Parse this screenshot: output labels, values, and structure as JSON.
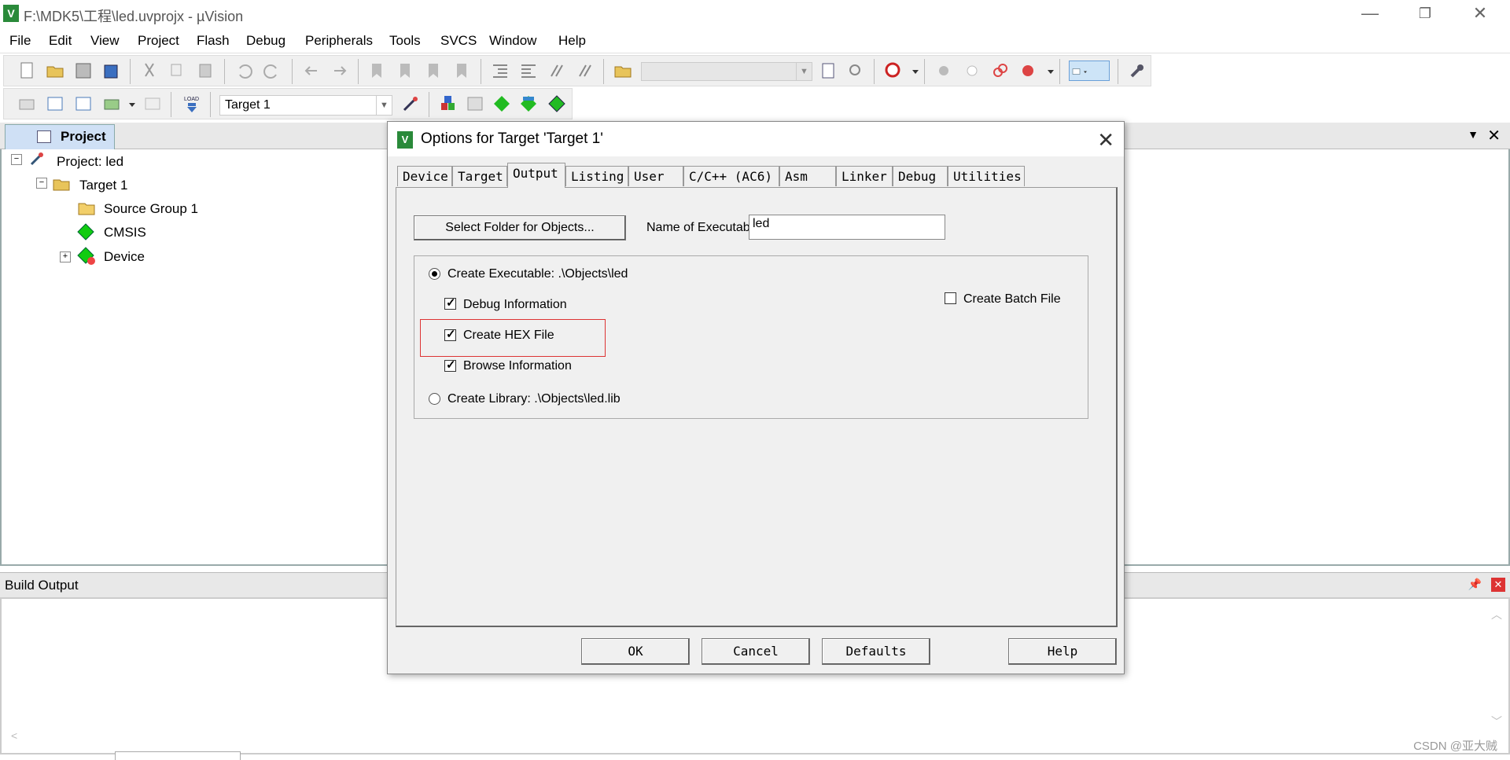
{
  "window": {
    "title": "F:\\MDK5\\工程\\led.uvprojx - µVision",
    "app_icon": "V"
  },
  "menubar": {
    "items": [
      "File",
      "Edit",
      "View",
      "Project",
      "Flash",
      "Debug",
      "Peripherals",
      "Tools",
      "SVCS",
      "Window",
      "Help"
    ]
  },
  "toolbar2": {
    "target_select": "Target 1",
    "load_label": "LOAD"
  },
  "project_panel": {
    "tab_label": "Project",
    "tree": [
      {
        "label": "Project: led"
      },
      {
        "label": "Target 1"
      },
      {
        "label": "Source Group 1"
      },
      {
        "label": "CMSIS"
      },
      {
        "label": "Device"
      }
    ]
  },
  "build_output": {
    "title": "Build Output"
  },
  "dialog": {
    "title": "Options for Target 'Target 1'",
    "tabs": [
      "Device",
      "Target",
      "Output",
      "Listing",
      "User",
      "C/C++ (AC6)",
      "Asm",
      "Linker",
      "Debug",
      "Utilities"
    ],
    "active_tab": "Output",
    "select_folder_button": "Select Folder for Objects...",
    "name_label": "Name of Executable:",
    "name_value": "led",
    "create_executable": "Create Executable:  .\\Objects\\led",
    "debug_info": "Debug Information",
    "create_hex": "Create HEX File",
    "browse_info": "Browse Information",
    "create_library": "Create Library:  .\\Objects\\led.lib",
    "create_batch": "Create Batch File",
    "buttons": {
      "ok": "OK",
      "cancel": "Cancel",
      "defaults": "Defaults",
      "help": "Help"
    }
  },
  "watermark": "CSDN @亚大贼",
  "colors": {
    "highlight": "#dd3333",
    "app_green": "#2a8a3a"
  }
}
